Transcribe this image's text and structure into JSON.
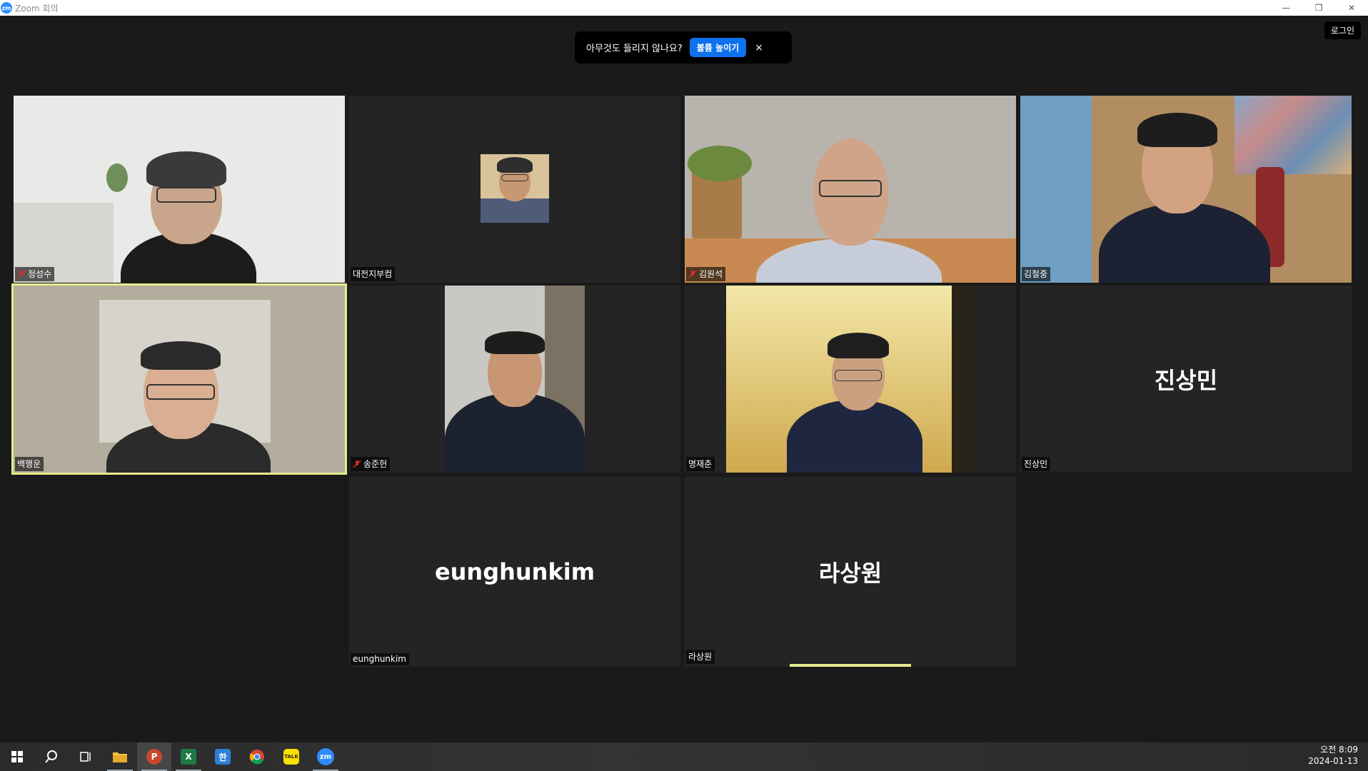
{
  "window": {
    "app_icon_text": "zm",
    "title": "Zoom 회의",
    "minimize": "—",
    "restore": "❐",
    "close": "✕"
  },
  "notice": {
    "message": "아무것도 들리지 않나요?",
    "action": "볼륨 높이기",
    "close": "×"
  },
  "login_button": "로그인",
  "participants": [
    {
      "name": "정성수",
      "muted": true,
      "video": true
    },
    {
      "name": "대전지부컴",
      "muted": false,
      "video": false,
      "avatar": true
    },
    {
      "name": "김원석",
      "muted": true,
      "video": true
    },
    {
      "name": "김철중",
      "muted": false,
      "video": true
    },
    {
      "name": "백행운",
      "muted": false,
      "video": true,
      "active_speaker": true
    },
    {
      "name": "송준헌",
      "muted": true,
      "video": true
    },
    {
      "name": "명재춘",
      "muted": false,
      "video": true
    },
    {
      "name": "진상민",
      "muted": false,
      "video": false,
      "display_name": "진상민"
    },
    {
      "name": "eunghunkim",
      "muted": false,
      "video": false,
      "display_name": "eunghunkim"
    },
    {
      "name": "라상원",
      "muted": false,
      "video": false,
      "display_name": "라상원"
    }
  ],
  "taskbar": {
    "apps": [
      "windows-start",
      "search",
      "task-view",
      "file-explorer",
      "powerpoint",
      "excel",
      "hancom",
      "chrome",
      "kakaotalk",
      "zoom"
    ],
    "ppt_label": "P",
    "excel_label": "X",
    "hancom_label": "한",
    "kakao_label": "TALK",
    "zoom_label": "zm",
    "clock_time": "오전 8:09",
    "clock_date": "2024-01-13"
  },
  "colors": {
    "background": "#1a1a1a",
    "tile": "#242424",
    "active_border": "#e6ec8c",
    "accent": "#0e72ed",
    "mic_muted": "#e02828"
  }
}
